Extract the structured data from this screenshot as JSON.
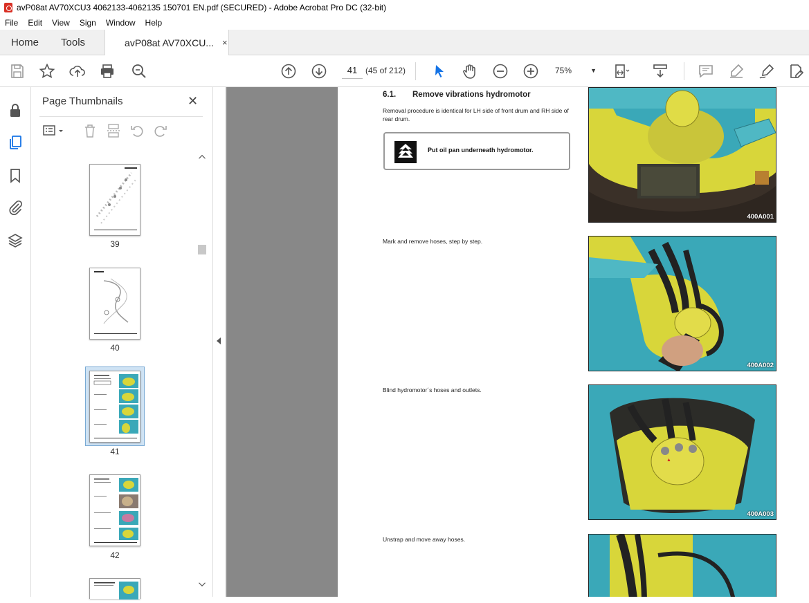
{
  "window": {
    "title": "avP08at AV70XCU3 4062133-4062135 150701 EN.pdf (SECURED) - Adobe Acrobat Pro DC (32-bit)"
  },
  "menu": [
    "File",
    "Edit",
    "View",
    "Sign",
    "Window",
    "Help"
  ],
  "tabs": {
    "home": "Home",
    "tools": "Tools",
    "document": "avP08at AV70XCU...",
    "close": "×"
  },
  "toolbar": {
    "page_current": "41",
    "page_count": "(45 of 212)",
    "zoom": "75%",
    "zoom_caret": "▼"
  },
  "thumbnails": {
    "title": "Page Thumbnails",
    "close": "✕",
    "items": [
      {
        "label": "39"
      },
      {
        "label": "40"
      },
      {
        "label": "41",
        "selected": true
      },
      {
        "label": "42"
      }
    ]
  },
  "document": {
    "section_number": "6.1.",
    "section_title": "Remove vibrations hydromotor",
    "intro": "Removal procedure is identical for LH side of front drum and RH side of rear drum.",
    "notice": "Put oil pan underneath hydromotor.",
    "steps": [
      {
        "text": "Mark and remove hoses, step by step."
      },
      {
        "text": "Blind hydromotor´s hoses and outlets."
      },
      {
        "text": "Unstrap and move away hoses."
      }
    ],
    "photos": [
      {
        "caption": "400A001"
      },
      {
        "caption": "400A002"
      },
      {
        "caption": "400A003"
      },
      {
        "caption": ""
      }
    ]
  },
  "colors": {
    "teal": "#3aa8b8",
    "yellow": "#d8d63a",
    "viewer_bg": "#888888",
    "accent_blue": "#1473e6"
  }
}
